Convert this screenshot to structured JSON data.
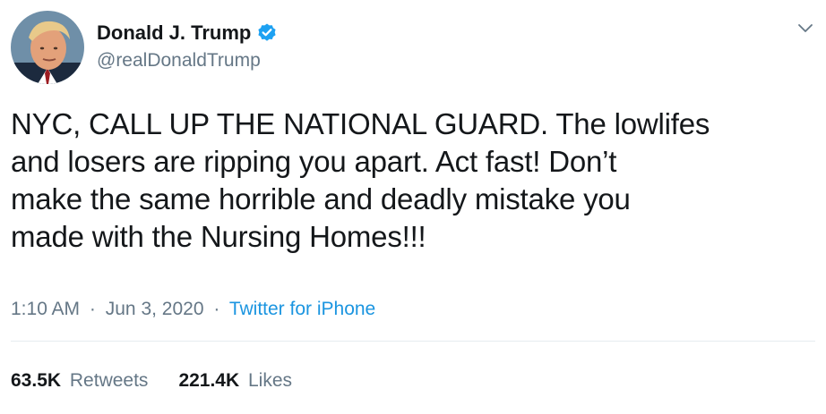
{
  "author": {
    "display_name": "Donald J. Trump",
    "handle": "@realDonaldTrump",
    "verified": true,
    "avatar_icon": "profile-photo",
    "verified_icon": "verified-badge-icon"
  },
  "tweet": {
    "lines": [
      "NYC, CALL UP THE NATIONAL GUARD. The lowlifes",
      "and losers are ripping you apart. Act fast! Don’t",
      "make the same horrible and deadly mistake you",
      "made with the Nursing Homes!!!"
    ]
  },
  "meta": {
    "time": "1:10 AM",
    "separator": "·",
    "date": "Jun 3, 2020",
    "source": "Twitter for iPhone"
  },
  "stats": {
    "retweets_count": "63.5K",
    "retweets_label": "Retweets",
    "likes_count": "221.4K",
    "likes_label": "Likes"
  },
  "colors": {
    "accent": "#1b95e0",
    "verified": "#1da1f2",
    "secondary_text": "#657786",
    "primary_text": "#14171a",
    "divider": "#e6ecf0"
  },
  "icons": {
    "more": "chevron-down-icon"
  }
}
